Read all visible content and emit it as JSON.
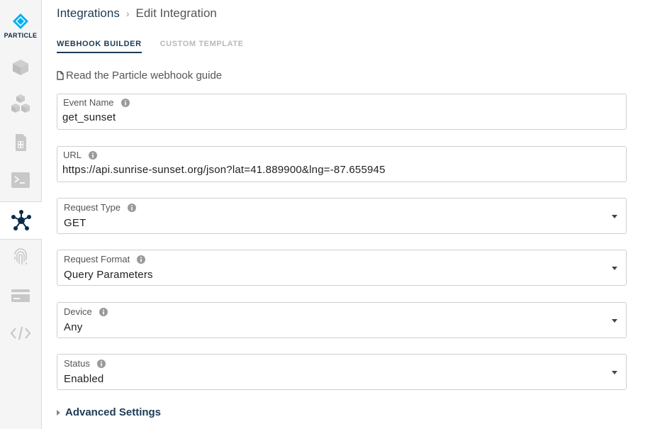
{
  "sidebar": {
    "logo_text": "PARTICLE",
    "brand_color": "#00aeef",
    "items": [
      {
        "icon": "cube-icon",
        "active": false
      },
      {
        "icon": "cubes-icon",
        "active": false
      },
      {
        "icon": "sim-card-icon",
        "active": false
      },
      {
        "icon": "terminal-icon",
        "active": false
      },
      {
        "icon": "integrations-icon",
        "active": true
      },
      {
        "icon": "fingerprint-icon",
        "active": false
      },
      {
        "icon": "credit-card-icon",
        "active": false
      },
      {
        "icon": "code-icon",
        "active": false
      }
    ]
  },
  "breadcrumb": {
    "parent": "Integrations",
    "current": "Edit Integration"
  },
  "tabs": {
    "webhook_builder": "WEBHOOK BUILDER",
    "custom_template": "CUSTOM TEMPLATE"
  },
  "guide_link": "Read the Particle webhook guide",
  "form": {
    "event_name": {
      "label": "Event Name",
      "value": "get_sunset"
    },
    "url": {
      "label": "URL",
      "value": "https://api.sunrise-sunset.org/json?lat=41.889900&lng=-87.655945"
    },
    "request_type": {
      "label": "Request Type",
      "value": "GET"
    },
    "request_format": {
      "label": "Request Format",
      "value": "Query Parameters"
    },
    "device": {
      "label": "Device",
      "value": "Any"
    },
    "status": {
      "label": "Status",
      "value": "Enabled"
    }
  },
  "advanced_settings": "Advanced Settings"
}
